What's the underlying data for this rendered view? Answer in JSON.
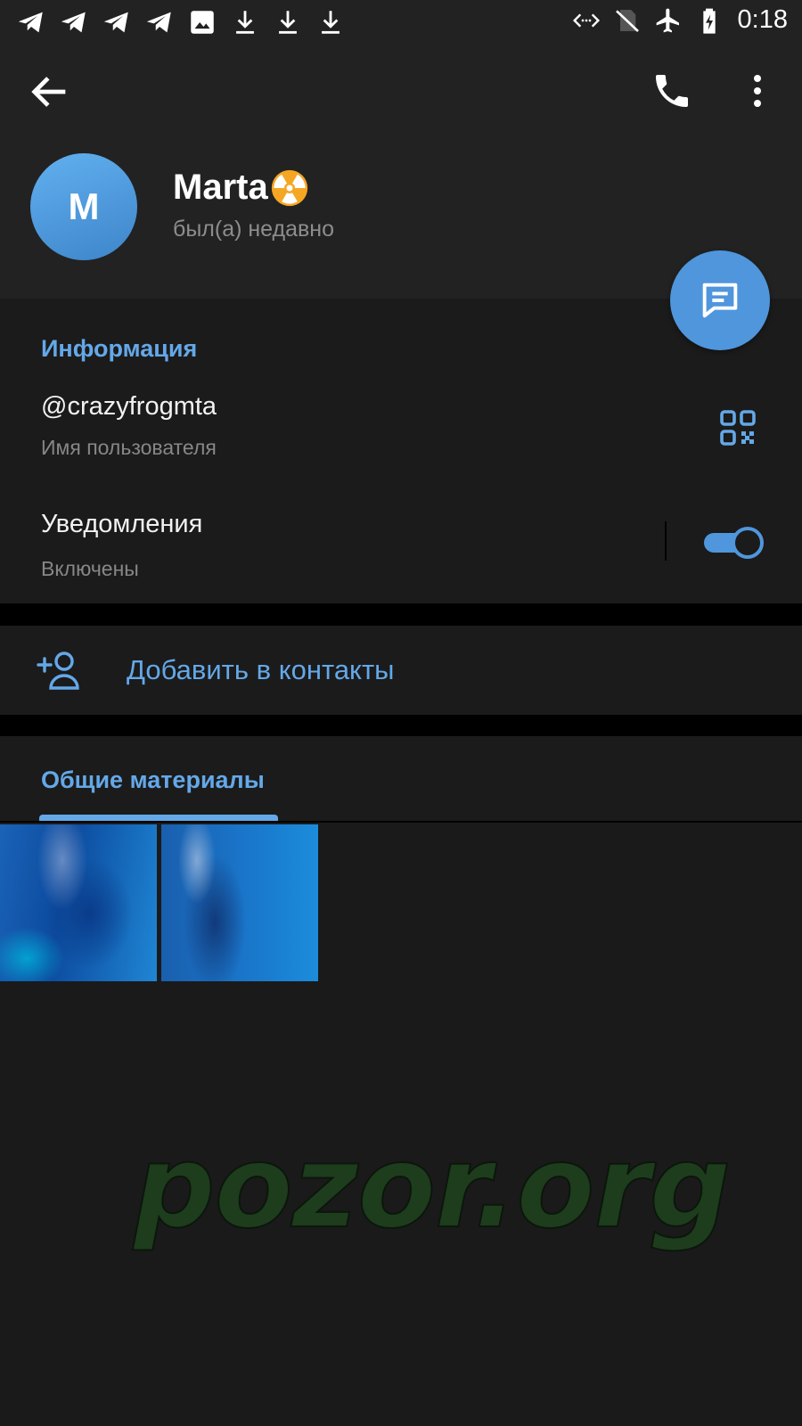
{
  "status_bar": {
    "time": "0:18",
    "left_icons": [
      "telegram-icon",
      "telegram-icon",
      "telegram-icon",
      "telegram-icon",
      "image-icon",
      "download-icon",
      "download-icon",
      "download-icon"
    ],
    "right_icons": [
      "data-saver-icon",
      "no-sim-icon",
      "airplane-icon",
      "battery-charging-icon"
    ]
  },
  "profile": {
    "avatar_letter": "M",
    "name": "Marta",
    "name_emoji": "radioactive-icon",
    "status": "был(а) недавно"
  },
  "info": {
    "section_title": "Информация",
    "username": "@crazyfrogmta",
    "username_label": "Имя пользователя",
    "notifications_title": "Уведомления",
    "notifications_value": "Включены",
    "notifications_enabled": true
  },
  "actions": {
    "add_contact": "Добавить в контакты"
  },
  "media": {
    "tab_label": "Общие материалы",
    "thumbnail_count": 2
  },
  "watermark": "pozor.org",
  "colors": {
    "accent": "#64a8e8",
    "fab": "#4f96dc",
    "header_bg": "#222222",
    "section_bg": "#1b1b1b"
  }
}
